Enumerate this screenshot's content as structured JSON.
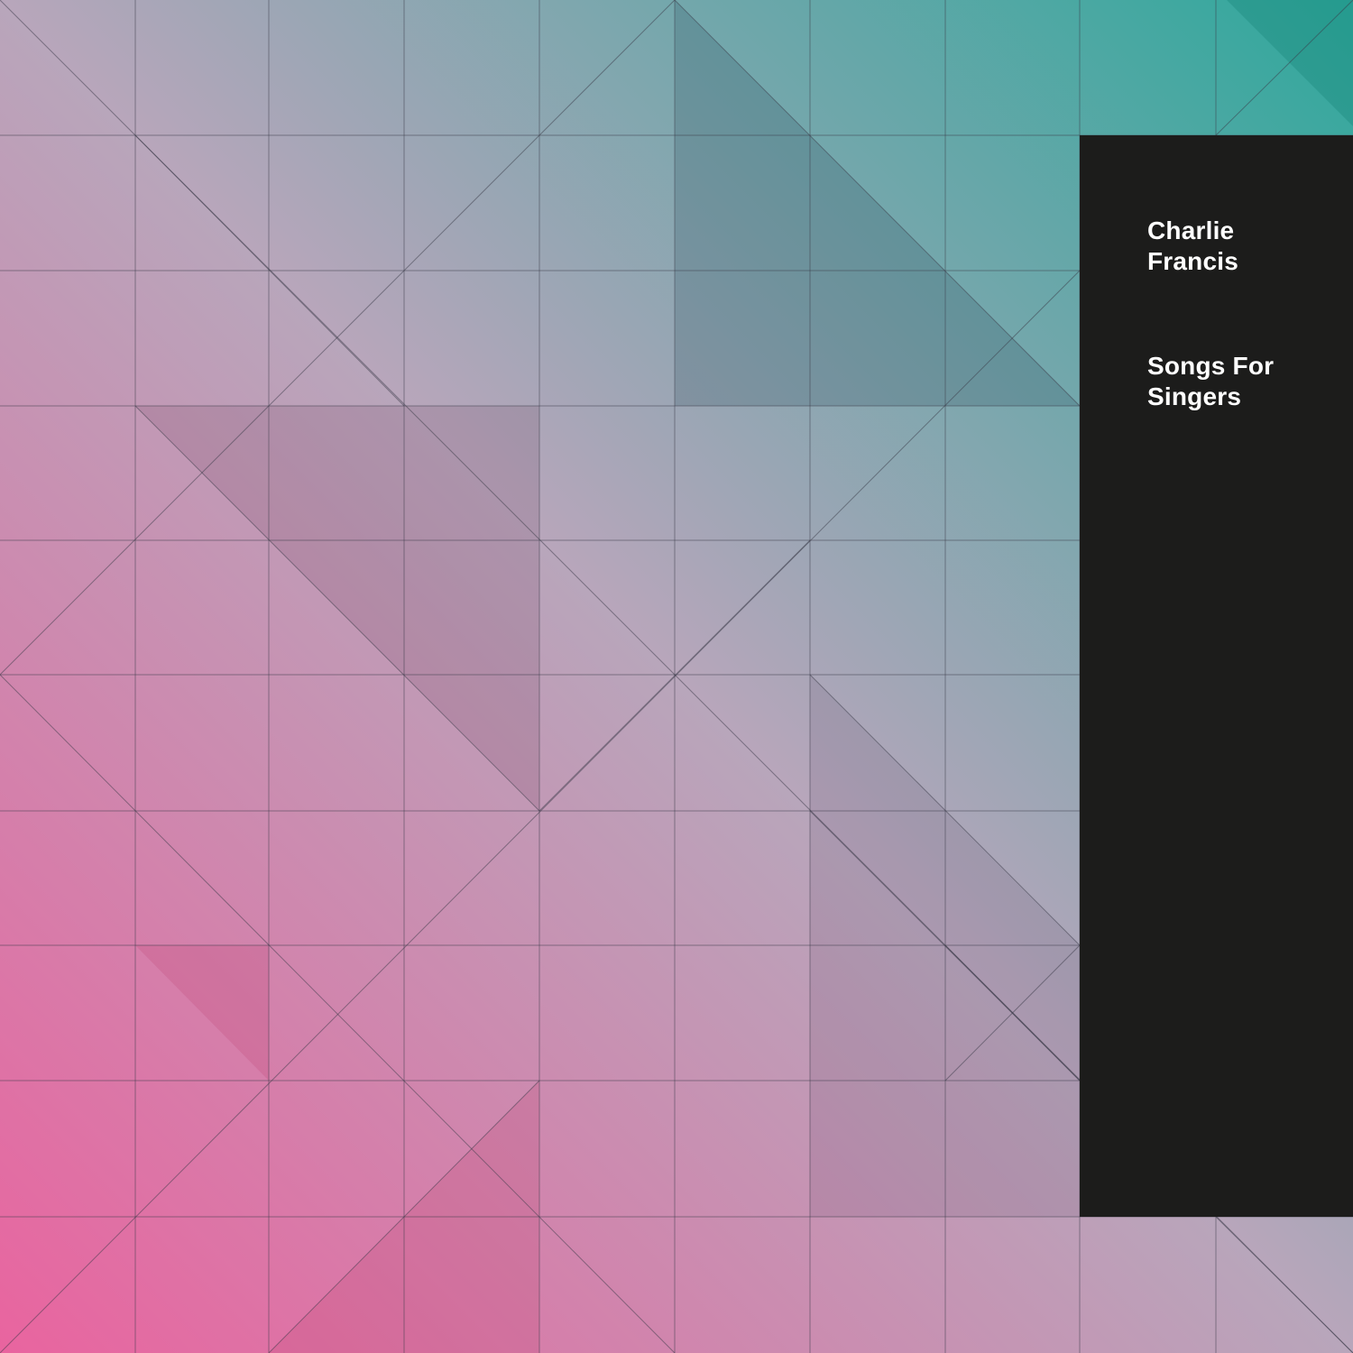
{
  "cover": {
    "artist_lines": [
      "Charlie",
      "Francis"
    ],
    "album_lines": [
      "Songs For",
      "Singers"
    ]
  },
  "colors": {
    "pink_corner": "#e9649f",
    "teal_corner": "#2ea89c",
    "panel": "#1c1c1b",
    "grid_line": "#3a3a48",
    "text": "#ffffff"
  }
}
